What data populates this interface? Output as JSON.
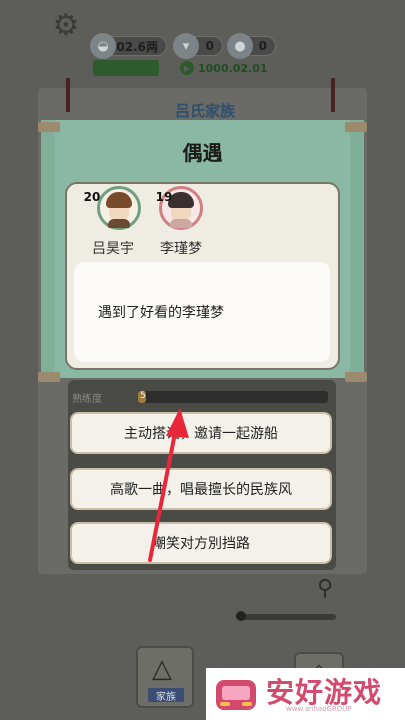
{
  "top_bar": {
    "settings_icon": "gear-icon",
    "money": "202.6两",
    "money_icon": "silver-ingot-icon",
    "resource_a": "0",
    "resource_a_icon": "boat-icon",
    "resource_b": "0",
    "resource_b_icon": "lantern-icon",
    "timer": "1000.02.01",
    "timer_icon": "play-icon"
  },
  "background": {
    "house_title": "吕氏家族",
    "skill_label": "熟练度",
    "skill_value": "5",
    "skill_progress": 0.04
  },
  "choices": [
    {
      "label": "主动搭话，邀请一起游船"
    },
    {
      "label": "高歌一曲，唱最擅长的民族风"
    },
    {
      "label": "嘲笑对方別挡路"
    }
  ],
  "nav": {
    "family_label": "家族",
    "family_icon": "network-icon",
    "right_icon": "pagoda-icon"
  },
  "modal": {
    "title": "偶遇",
    "person_1": {
      "age": "20",
      "name": "吕昊宇"
    },
    "person_2": {
      "age": "19",
      "name": "李瑾梦"
    },
    "message": "遇到了好看的李瑾梦"
  },
  "watermark": {
    "text": "安好游戏",
    "url": "www.anhaoGROUP"
  },
  "colors": {
    "modal_band": "#8ab8a4",
    "avatar_male_ring": "#6f9f7d",
    "avatar_female_ring": "#d08080",
    "arrow": "#e8283a",
    "watermark_text": "#d34a6f"
  }
}
